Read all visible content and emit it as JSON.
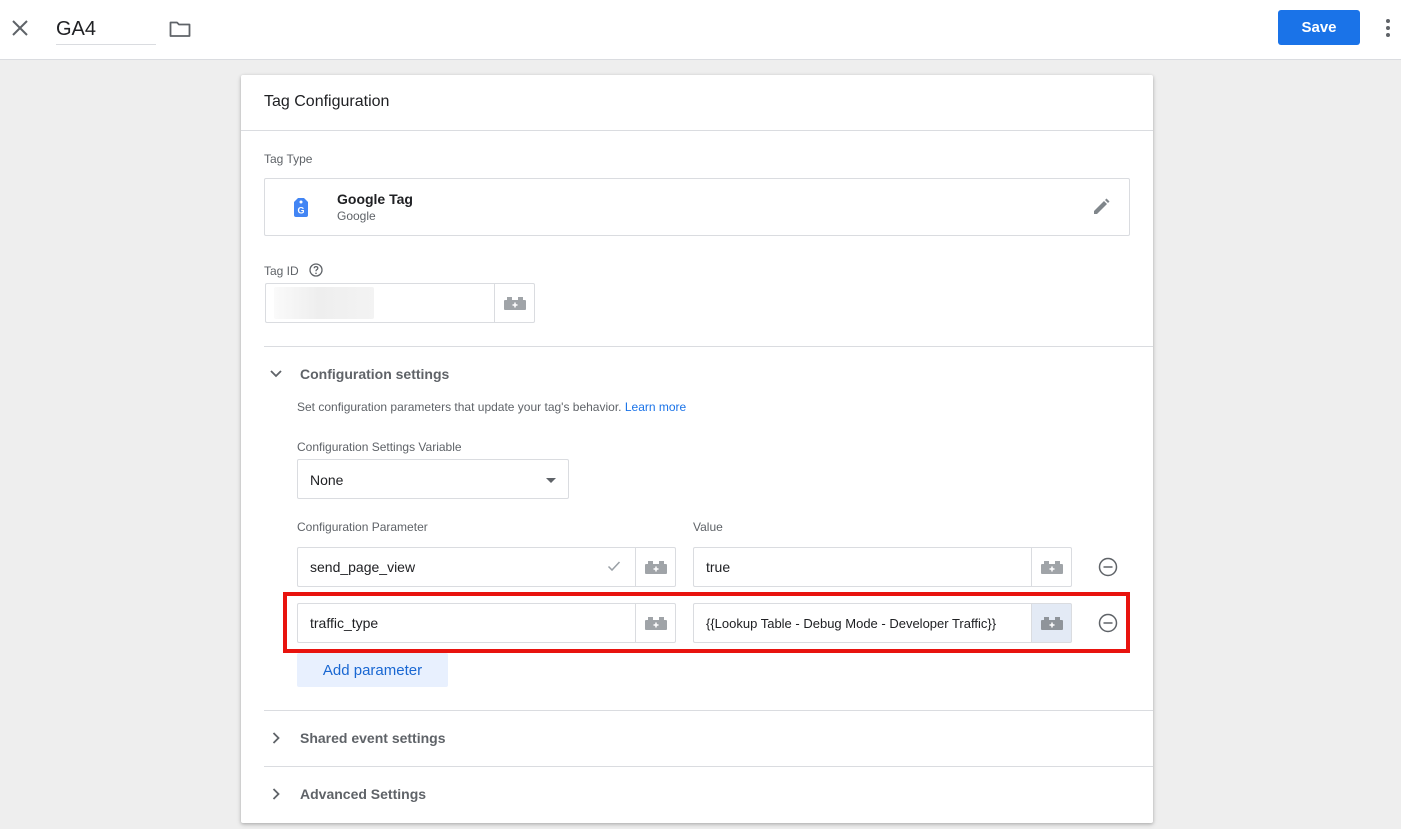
{
  "topbar": {
    "tag_name": "GA4",
    "save_label": "Save"
  },
  "card": {
    "title": "Tag Configuration",
    "tag_type": {
      "label": "Tag Type",
      "name": "Google Tag",
      "vendor": "Google",
      "icon_letter": "G"
    },
    "tag_id": {
      "label": "Tag ID",
      "value": ""
    },
    "config": {
      "title": "Configuration settings",
      "description": "Set configuration parameters that update your tag's behavior.",
      "learn_more": "Learn more",
      "settings_var_label": "Configuration Settings Variable",
      "settings_var_value": "None",
      "param_header": "Configuration Parameter",
      "value_header": "Value",
      "rows": [
        {
          "param": "send_page_view",
          "value": "true"
        },
        {
          "param": "traffic_type",
          "value": "{{Lookup Table - Debug Mode - Developer Traffic}}"
        }
      ],
      "add_label": "Add parameter"
    },
    "shared_events": {
      "title": "Shared event settings"
    },
    "advanced": {
      "title": "Advanced Settings"
    }
  },
  "colors": {
    "accent": "#1a73e8",
    "highlight": "#e8130e"
  }
}
